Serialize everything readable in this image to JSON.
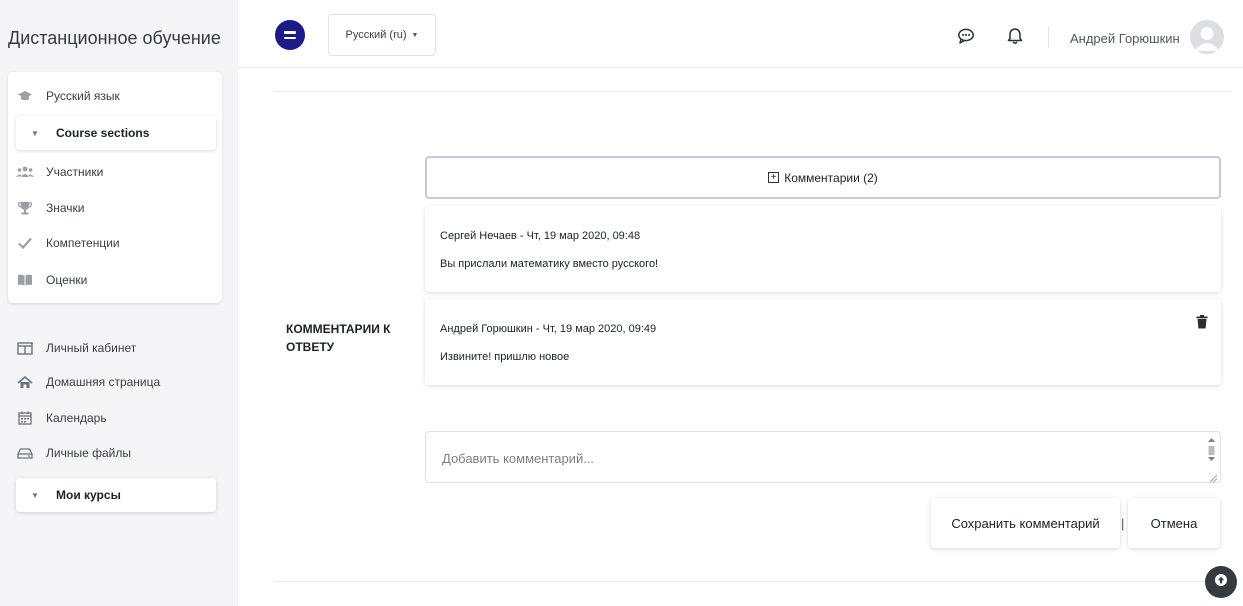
{
  "drawer": {
    "brand": "Дистанционное обучение",
    "course_items": [
      {
        "label": "Русский язык",
        "icon": "graduation-cap-icon"
      }
    ],
    "course_sections_label": "Course sections",
    "course_nav": [
      {
        "label": "Участники",
        "icon": "users-icon"
      },
      {
        "label": "Значки",
        "icon": "trophy-icon"
      },
      {
        "label": "Компетенции",
        "icon": "check-icon"
      },
      {
        "label": "Оценки",
        "icon": "book-icon"
      }
    ],
    "site_nav": [
      {
        "label": "Личный кабинет",
        "icon": "dashboard-icon"
      },
      {
        "label": "Домашняя страница",
        "icon": "home-icon"
      },
      {
        "label": "Календарь",
        "icon": "calendar-icon"
      },
      {
        "label": "Личные файлы",
        "icon": "drive-icon"
      }
    ],
    "my_courses_label": "Мои курсы"
  },
  "topbar": {
    "language": "Русский (ru)",
    "user_name": "Андрей Горюшкин",
    "icons": [
      "logo-icon",
      "messages-icon",
      "notifications-icon",
      "user-avatar"
    ]
  },
  "main": {
    "field_label": "Комментарии к ответу",
    "comments_toggle": "Комментарии (2)",
    "comments": [
      {
        "author": "Сергей Нечаев",
        "date": "Чт, 19 мар 2020, 09:48",
        "text": "Вы прислали математику вместо русского!",
        "deletable": false
      },
      {
        "author": "Андрей Горюшкин",
        "date": "Чт, 19 мар 2020, 09:49",
        "text": "Извините! пришлю новое",
        "deletable": true
      }
    ],
    "comment_placeholder": "Добавить комментарий...",
    "save_label": "Сохранить комментарий",
    "separator": "|",
    "cancel_label": "Отмена"
  },
  "colors": {
    "brand": "#1a1a8a",
    "drawer_bg": "#f5f5f8",
    "toggle_border": "#c8c8e2",
    "back_to_top": "#343a40"
  }
}
